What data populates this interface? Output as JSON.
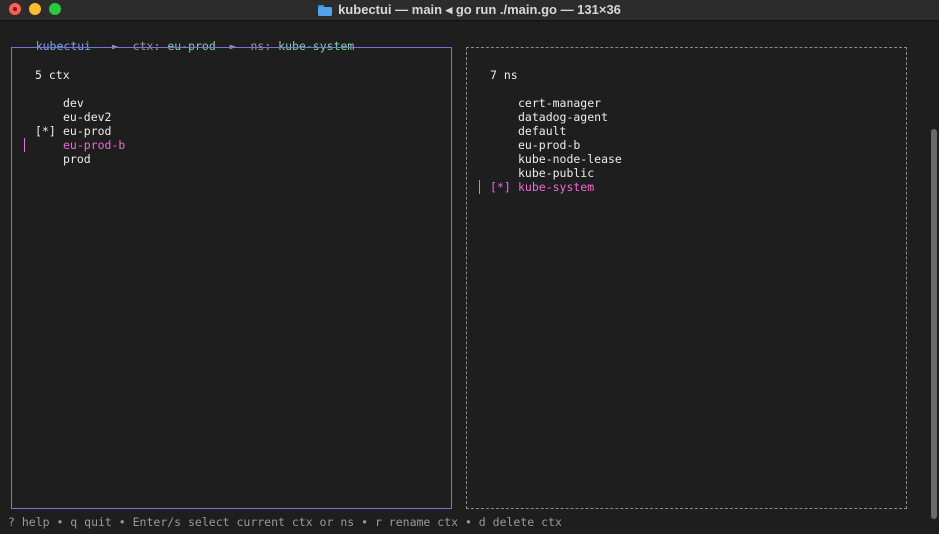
{
  "window": {
    "title": "kubectui — main ◂ go run ./main.go — 131×36",
    "icon": "folder-icon"
  },
  "breadcrumb": {
    "app": "kubectui",
    "sep1": "►",
    "ctx_label": "ctx:",
    "ctx_value": "eu-prod",
    "sep2": "►",
    "ns_label": "ns:",
    "ns_value": "kube-system"
  },
  "contexts": {
    "header": "5 ctx",
    "items": [
      {
        "marker": "",
        "name": "dev"
      },
      {
        "marker": "",
        "name": "eu-dev2"
      },
      {
        "marker": "[*]",
        "name": "eu-prod"
      },
      {
        "marker": "",
        "name": "eu-prod-b"
      },
      {
        "marker": "",
        "name": "prod"
      }
    ]
  },
  "namespaces": {
    "header": "7 ns",
    "items": [
      {
        "marker": "",
        "name": "cert-manager"
      },
      {
        "marker": "",
        "name": "datadog-agent"
      },
      {
        "marker": "",
        "name": "default"
      },
      {
        "marker": "",
        "name": "eu-prod-b"
      },
      {
        "marker": "",
        "name": "kube-node-lease"
      },
      {
        "marker": "",
        "name": "kube-public"
      },
      {
        "marker": "[*]",
        "name": "kube-system"
      }
    ]
  },
  "footer": {
    "text": "? help • q quit • Enter/s select current ctx or ns • r rename ctx • d delete ctx"
  },
  "colors": {
    "accent_pink": "#ee6bd6",
    "accent_blue": "#76a7e8",
    "accent_green": "#7ed2a2",
    "pane_border_active": "#7b73d4"
  }
}
